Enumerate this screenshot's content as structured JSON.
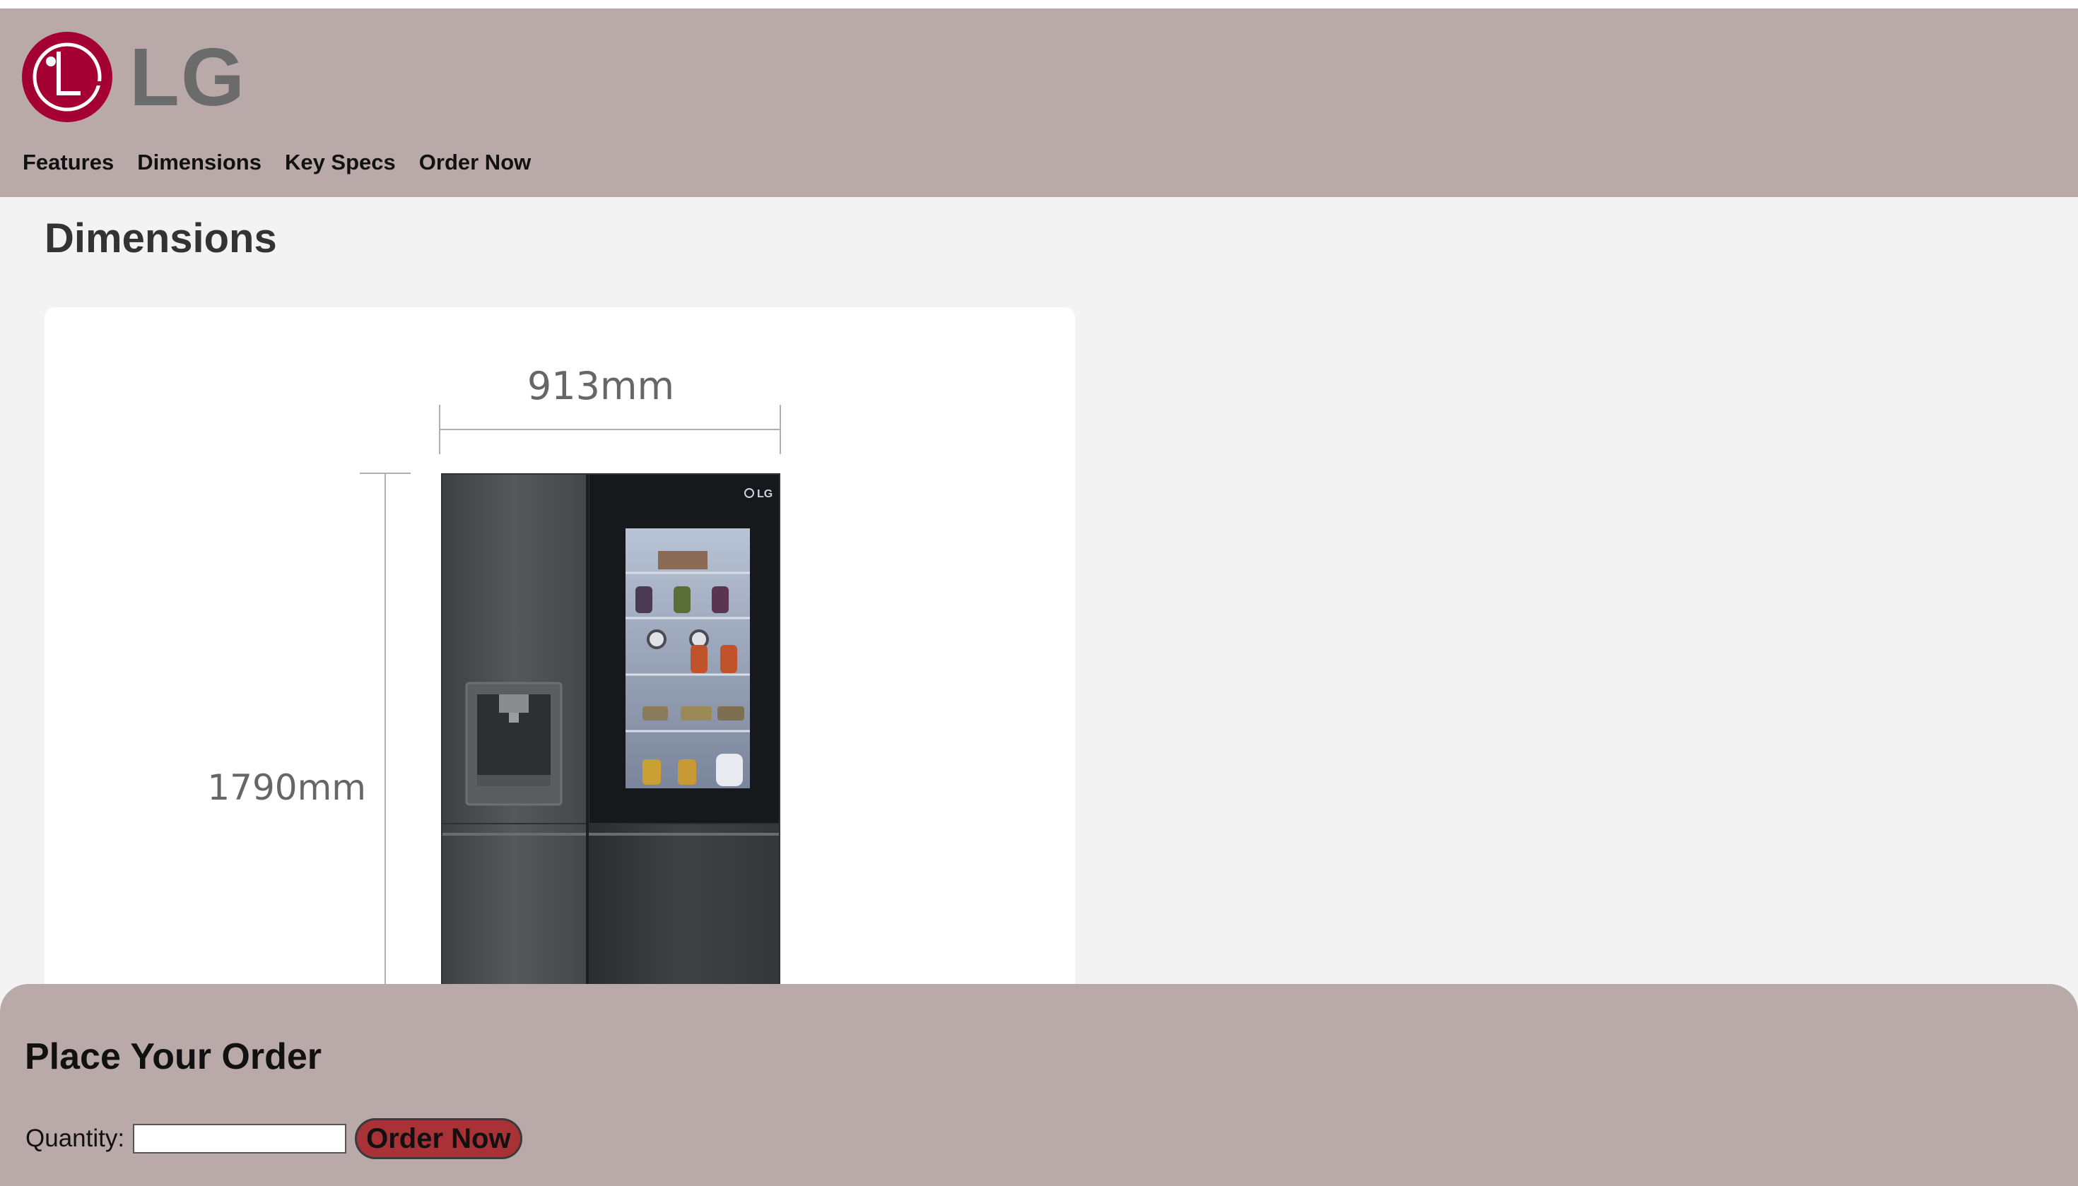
{
  "brand": {
    "logo_text": "LG",
    "logo_color": "#a50034"
  },
  "nav": {
    "items": [
      {
        "label": "Features"
      },
      {
        "label": "Dimensions"
      },
      {
        "label": "Key Specs"
      },
      {
        "label": "Order Now"
      }
    ]
  },
  "dimensions": {
    "title": "Dimensions",
    "width_label": "913mm",
    "height_label": "1790mm",
    "fridge_badge": "LG"
  },
  "order": {
    "title": "Place Your Order",
    "quantity_label": "Quantity:",
    "quantity_value": "",
    "button_label": "Order Now",
    "button_color": "#a93237"
  },
  "colors": {
    "header_bg": "#b9aaa9",
    "page_bg": "#f3f3f3"
  }
}
